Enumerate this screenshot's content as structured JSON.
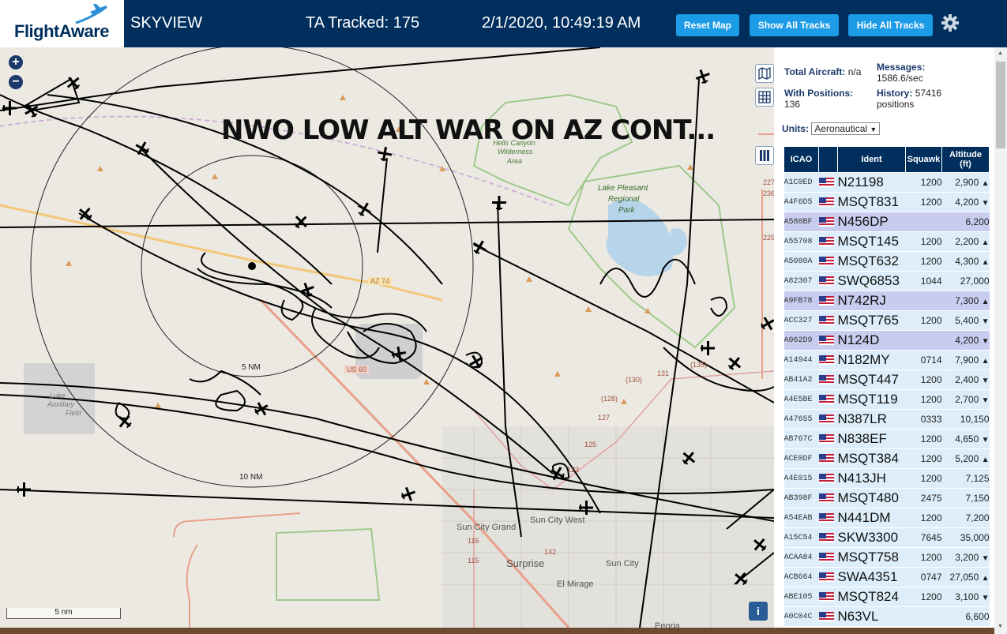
{
  "header": {
    "brand": "FlightAware",
    "site_name": "SKYVIEW",
    "tracked": "TA Tracked: 175",
    "datetime": "2/1/2020, 10:49:19 AM",
    "buttons": {
      "reset": "Reset Map",
      "show_all": "Show All Tracks",
      "hide_all": "Hide All Tracks"
    },
    "settings_icon": "gear-icon",
    "bg_color": "#002f5d",
    "button_color": "#1c9be6"
  },
  "map": {
    "overlay_title": "NWO LOW ALT WAR ON AZ CONT...",
    "range_labels": [
      "5 NM",
      "10 NM"
    ],
    "scale": "5 nm",
    "places": [
      "Hells Canyon",
      "Wilderness",
      "Area",
      "Lake Pleasant",
      "Regional",
      "Park",
      "Sun City Grand",
      "Sun City West",
      "Surprise",
      "Sun City",
      "El Mirage",
      "Peoria",
      "Luke",
      "Auxiliary",
      "Field"
    ],
    "roads": [
      "AZ 74",
      "US 60",
      "(130)",
      "(128)",
      "(135)",
      "131",
      "127",
      "125",
      "123",
      "115",
      "116",
      "142",
      "229",
      "227",
      "236",
      "Sun City West"
    ],
    "controls": {
      "zoom_in": "+",
      "zoom_out": "−",
      "info": "i"
    }
  },
  "panel": {
    "total_aircraft_label": "Total Aircraft:",
    "total_aircraft_value": "n/a",
    "messages_label": "Messages:",
    "messages_value": "1586.6/sec",
    "with_positions_label": "With Positions:",
    "with_positions_value": "136",
    "history_label": "History:",
    "history_value": "57416",
    "history_unit": "positions",
    "units_label": "Units:",
    "units_value": "Aeronautical"
  },
  "table": {
    "headers": {
      "icao": "ICAO",
      "ident": "Ident",
      "squawk": "Squawk",
      "altitude": "Altitude",
      "altitude_unit": "(ft)"
    },
    "rows": [
      {
        "icao": "A1C0ED",
        "ident": "N21198",
        "squawk": "1200",
        "alt": "2,900",
        "trend": "▲"
      },
      {
        "icao": "A4F6D5",
        "ident": "MSQT831",
        "squawk": "1200",
        "alt": "4,200",
        "trend": "▼"
      },
      {
        "icao": "A588BF",
        "ident": "N456DP",
        "squawk": "",
        "alt": "6,200",
        "trend": ""
      },
      {
        "icao": "A55708",
        "ident": "MSQT145",
        "squawk": "1200",
        "alt": "2,200",
        "trend": "▲"
      },
      {
        "icao": "A5080A",
        "ident": "MSQT632",
        "squawk": "1200",
        "alt": "4,300",
        "trend": "▲"
      },
      {
        "icao": "A82307",
        "ident": "SWQ6853",
        "squawk": "1044",
        "alt": "27,000",
        "trend": ""
      },
      {
        "icao": "A9FB78",
        "ident": "N742RJ",
        "squawk": "",
        "alt": "7,300",
        "trend": "▲"
      },
      {
        "icao": "ACC327",
        "ident": "MSQT765",
        "squawk": "1200",
        "alt": "5,400",
        "trend": "▼"
      },
      {
        "icao": "A062D9",
        "ident": "N124D",
        "squawk": "",
        "alt": "4,200",
        "trend": "▼"
      },
      {
        "icao": "A14944",
        "ident": "N182MY",
        "squawk": "0714",
        "alt": "7,900",
        "trend": "▲"
      },
      {
        "icao": "AB41A2",
        "ident": "MSQT447",
        "squawk": "1200",
        "alt": "2,400",
        "trend": "▼"
      },
      {
        "icao": "A4E5BE",
        "ident": "MSQT119",
        "squawk": "1200",
        "alt": "2,700",
        "trend": "▼"
      },
      {
        "icao": "A47655",
        "ident": "N387LR",
        "squawk": "0333",
        "alt": "10,150",
        "trend": ""
      },
      {
        "icao": "AB767C",
        "ident": "N838EF",
        "squawk": "1200",
        "alt": "4,650",
        "trend": "▼"
      },
      {
        "icao": "ACE0DF",
        "ident": "MSQT384",
        "squawk": "1200",
        "alt": "5,200",
        "trend": "▲"
      },
      {
        "icao": "A4E015",
        "ident": "N413JH",
        "squawk": "1200",
        "alt": "7,125",
        "trend": ""
      },
      {
        "icao": "AB398F",
        "ident": "MSQT480",
        "squawk": "2475",
        "alt": "7,150",
        "trend": ""
      },
      {
        "icao": "A54EAB",
        "ident": "N441DM",
        "squawk": "1200",
        "alt": "7,200",
        "trend": ""
      },
      {
        "icao": "A15C54",
        "ident": "SKW3300",
        "squawk": "7645",
        "alt": "35,000",
        "trend": ""
      },
      {
        "icao": "ACAA84",
        "ident": "MSQT758",
        "squawk": "1200",
        "alt": "3,200",
        "trend": "▼"
      },
      {
        "icao": "ACB664",
        "ident": "SWA4351",
        "squawk": "0747",
        "alt": "27,050",
        "trend": "▲"
      },
      {
        "icao": "ABE105",
        "ident": "MSQT824",
        "squawk": "1200",
        "alt": "3,100",
        "trend": "▼"
      },
      {
        "icao": "A0C04C",
        "ident": "N63VL",
        "squawk": "",
        "alt": "6,600",
        "trend": ""
      }
    ],
    "selected_rows": [
      2,
      6,
      8
    ]
  }
}
